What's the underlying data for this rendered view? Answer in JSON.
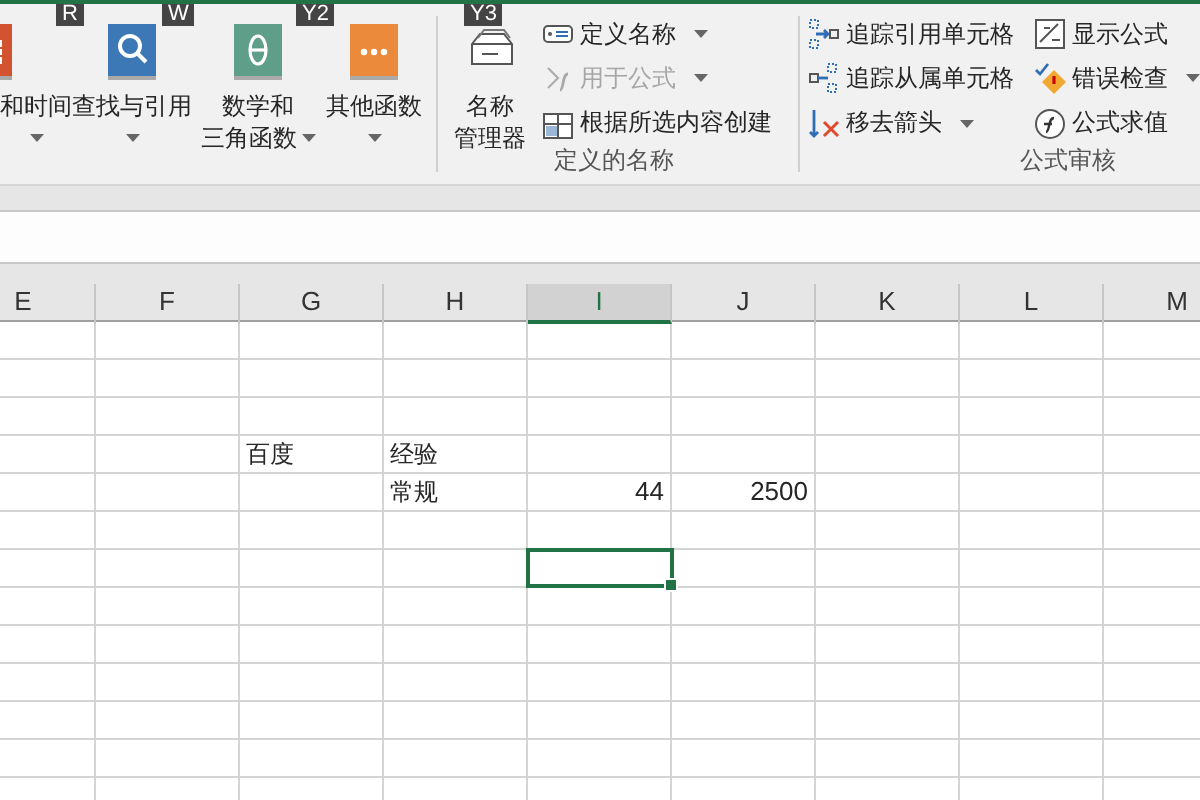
{
  "ribbon": {
    "function_buttons": [
      {
        "lines": [
          "和时间"
        ],
        "key_tip": "R",
        "dropdown": true
      },
      {
        "lines": [
          "查找与引用"
        ],
        "key_tip": "W",
        "dropdown": true
      },
      {
        "lines": [
          "数学和",
          "三角函数"
        ],
        "key_tip": "Y2",
        "dropdown": true
      },
      {
        "lines": [
          "其他函数"
        ],
        "dropdown": true
      }
    ],
    "name_manager": {
      "lines": [
        "名称",
        "管理器"
      ],
      "key_tip": "Y3"
    },
    "defined_names": {
      "commands": [
        {
          "label": "定义名称",
          "disabled": false,
          "dropdown": true
        },
        {
          "label": "用于公式",
          "disabled": true,
          "dropdown": true
        },
        {
          "label": "根据所选内容创建",
          "disabled": false,
          "dropdown": false
        }
      ],
      "group_label": "定义的名称"
    },
    "formula_auditing": {
      "commands": [
        {
          "label": "追踪引用单元格",
          "dropdown": false
        },
        {
          "label": "追踪从属单元格",
          "dropdown": false
        },
        {
          "label": "移去箭头",
          "dropdown": true
        },
        {
          "label": "显示公式",
          "dropdown": false
        },
        {
          "label": "错误检查",
          "dropdown": true
        },
        {
          "label": "公式求值",
          "dropdown": false
        }
      ],
      "group_label": "公式审核"
    }
  },
  "sheet": {
    "columns": [
      {
        "label": "E",
        "selected": false
      },
      {
        "label": "F",
        "selected": false
      },
      {
        "label": "G",
        "selected": false
      },
      {
        "label": "H",
        "selected": false
      },
      {
        "label": "I",
        "selected": true
      },
      {
        "label": "J",
        "selected": false
      },
      {
        "label": "K",
        "selected": false
      },
      {
        "label": "L",
        "selected": false
      },
      {
        "label": "M",
        "selected": false
      }
    ],
    "rows": [
      {
        "cells": [
          null,
          null,
          null,
          null,
          null,
          null,
          null,
          null,
          null
        ]
      },
      {
        "cells": [
          null,
          null,
          null,
          null,
          null,
          null,
          null,
          null,
          null
        ]
      },
      {
        "cells": [
          null,
          null,
          null,
          null,
          null,
          null,
          null,
          null,
          null
        ]
      },
      {
        "cells": [
          null,
          null,
          {
            "text": "百度",
            "kind": "text",
            "active": false
          },
          {
            "text": "经验",
            "kind": "text",
            "active": false
          },
          null,
          null,
          null,
          null,
          null
        ]
      },
      {
        "cells": [
          null,
          null,
          null,
          {
            "text": "常规",
            "kind": "text",
            "active": false
          },
          {
            "text": "44",
            "kind": "number",
            "active": false
          },
          {
            "text": "2500",
            "kind": "number",
            "active": false
          },
          null,
          null,
          null
        ]
      },
      {
        "cells": [
          null,
          null,
          null,
          null,
          null,
          null,
          null,
          null,
          null
        ]
      },
      {
        "cells": [
          null,
          null,
          null,
          null,
          {
            "active": true
          },
          null,
          null,
          null,
          null
        ]
      },
      {
        "cells": [
          null,
          null,
          null,
          null,
          null,
          null,
          null,
          null,
          null
        ]
      },
      {
        "cells": [
          null,
          null,
          null,
          null,
          null,
          null,
          null,
          null,
          null
        ]
      },
      {
        "cells": [
          null,
          null,
          null,
          null,
          null,
          null,
          null,
          null,
          null
        ]
      },
      {
        "cells": [
          null,
          null,
          null,
          null,
          null,
          null,
          null,
          null,
          null
        ]
      },
      {
        "cells": [
          null,
          null,
          null,
          null,
          null,
          null,
          null,
          null,
          null
        ]
      },
      {
        "cells": [
          null,
          null,
          null,
          null,
          null,
          null,
          null,
          null,
          null
        ]
      }
    ]
  }
}
